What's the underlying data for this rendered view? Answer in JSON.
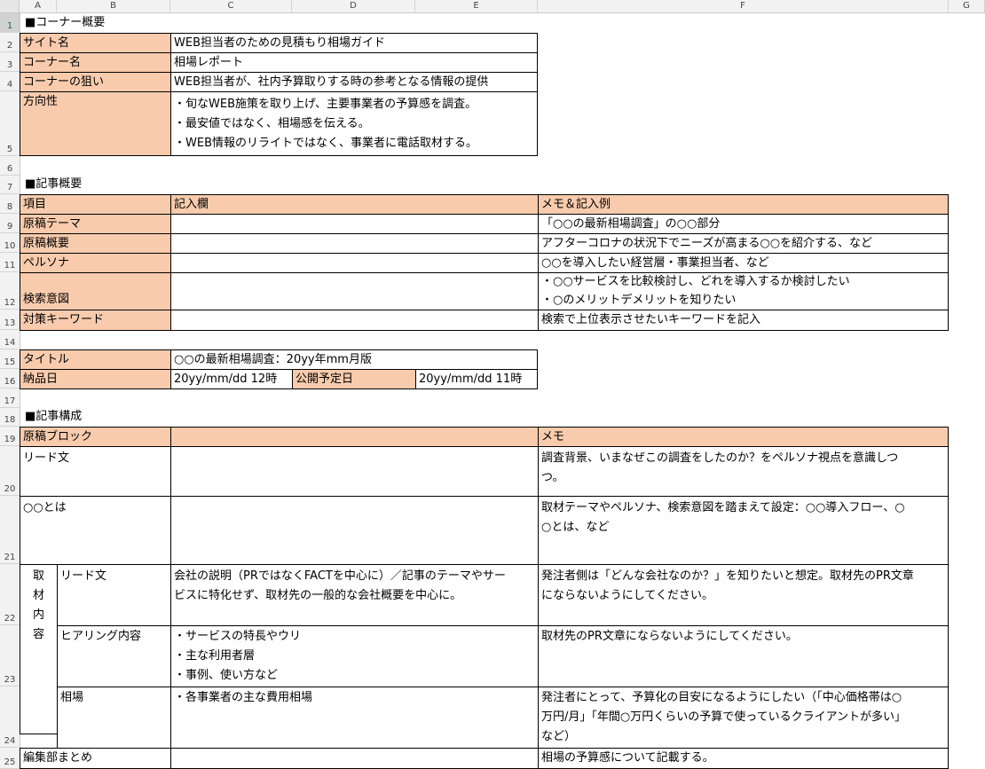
{
  "columns": [
    "A",
    "B",
    "C",
    "D",
    "E",
    "F",
    "G"
  ],
  "rows": [
    "1",
    "2",
    "3",
    "4",
    "5",
    "6",
    "7",
    "8",
    "9",
    "10",
    "11",
    "12",
    "13",
    "14",
    "15",
    "16",
    "17",
    "18",
    "19",
    "20",
    "21",
    "22",
    "23",
    "24",
    "25"
  ],
  "corner_overview": {
    "heading": "■コーナー概要",
    "site_label": "サイト名",
    "site_value": "WEB担当者のための見積もり相場ガイド",
    "corner_label": "コーナー名",
    "corner_value": "相場レポート",
    "aim_label": "コーナーの狙い",
    "aim_value": "WEB担当者が、社内予算取りする時の参考となる情報の提供",
    "direction_label": "方向性",
    "direction_lines": [
      "・旬なWEB施策を取り上げ、主要事業者の予算感を調査。",
      "・最安値ではなく、相場感を伝える。",
      "・WEB情報のリライトではなく、事業者に電話取材する。"
    ]
  },
  "article_overview": {
    "heading": "■記事概要",
    "header_item": "項目",
    "header_entry": "記入欄",
    "header_memo": "メモ＆記入例",
    "rows": [
      {
        "label": "原稿テーマ",
        "entry": "",
        "memo": [
          "「○○の最新相場調査」の○○部分"
        ]
      },
      {
        "label": "原稿概要",
        "entry": "",
        "memo": [
          "アフターコロナの状況下でニーズが高まる○○を紹介する、など"
        ]
      },
      {
        "label": "ペルソナ",
        "entry": "",
        "memo": [
          "○○を導入したい経営層・事業担当者、など"
        ]
      },
      {
        "label": "検索意図",
        "entry": "",
        "memo": [
          "・○○サービスを比較検討し、どれを導入するか検討したい",
          "・○のメリットデメリットを知りたい"
        ]
      },
      {
        "label": "対策キーワード",
        "entry": "",
        "memo": [
          "検索で上位表示させたいキーワードを記入"
        ]
      }
    ],
    "title_label": "タイトル",
    "title_value": "○○の最新相場調査：20yy年mm月版",
    "delivery_label": "納品日",
    "delivery_value": "20yy/mm/dd 12時",
    "publish_label": "公開予定日",
    "publish_value": "20yy/mm/dd 11時"
  },
  "article_structure": {
    "heading": "■記事構成",
    "header_block": "原稿ブロック",
    "header_entry": "",
    "header_memo": "メモ",
    "lead_label": "リード文",
    "lead_memo": [
      "調査背景、いまなぜこの調査をしたのか？をペルソナ視点を意識しつ",
      "つ。"
    ],
    "about_label": "○○とは",
    "about_memo": [
      "取材テーマやペルソナ、検索意図を踏まえて設定：○○導入フロー、○",
      "○とは、など"
    ],
    "interview_group": [
      "取",
      "材",
      "内",
      "容"
    ],
    "interview_lead_label": "リード文",
    "interview_lead_entry": [
      "会社の説明（PRではなくFACTを中心に）／記事のテーマやサー",
      "ビスに特化せず、取材先の一般的な会社概要を中心に。"
    ],
    "interview_lead_memo": [
      "発注者側は「どんな会社なのか？」を知りたいと想定。取材先のPR文章",
      "にならないようにしてください。"
    ],
    "hearing_label": "ヒアリング内容",
    "hearing_entry": [
      "・サービスの特長やウリ",
      "・主な利用者層",
      "・事例、使い方など"
    ],
    "hearing_memo": [
      "取材先のPR文章にならないようにしてください。"
    ],
    "price_label": "相場",
    "price_entry": [
      "・各事業者の主な費用相場"
    ],
    "price_memo": [
      "発注者にとって、予算化の目安になるようにしたい（「中心価格帯は○",
      "万円/月」「年間○万円くらいの予算で使っているクライアントが多い」",
      "など）"
    ],
    "summary_label": "編集部まとめ",
    "summary_memo": [
      "相場の予算感について記載する。"
    ]
  }
}
